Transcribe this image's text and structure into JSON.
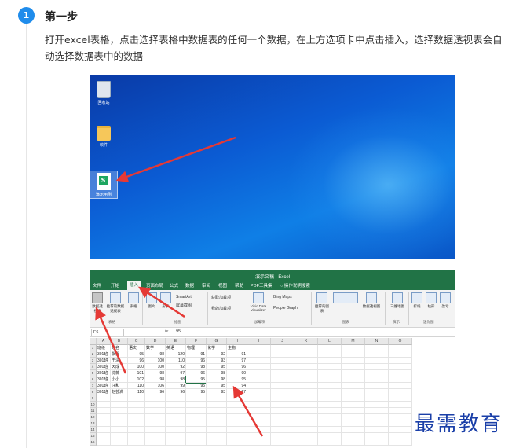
{
  "step": {
    "number": "1",
    "title": "第一步",
    "description": "打开excel表格，点击选择表格中数据表的任何一个数据，在上方选项卡中点击插入，选择数据透视表会自动选择数据表中的数据"
  },
  "desktop": {
    "icons": [
      {
        "name": "recycle-bin",
        "label": "回收站"
      },
      {
        "name": "folder",
        "label": "软件"
      },
      {
        "name": "wps-sheet",
        "label": "演示用例"
      }
    ]
  },
  "excel": {
    "title": "演示文稿 - Excel",
    "tabs": [
      "文件",
      "开始",
      "插入",
      "页面布局",
      "公式",
      "数据",
      "审阅",
      "视图",
      "帮助",
      "PDF工具集",
      "操作说明搜索"
    ],
    "active_tab": "插入",
    "ribbon": {
      "pivot_table": "数据透视表",
      "recommended_pivot": "推荐的数据透视表",
      "table": "表格",
      "group_tables": "表格",
      "pictures": "图片",
      "shapes": "形状",
      "smartart": "SmartArt",
      "screenshot": "屏幕截图",
      "group_illustrations": "插图",
      "get_addins": "获取加载项",
      "my_addins": "我的加载项",
      "visio": "Visio Data Visualizer",
      "bing_maps": "Bing Maps",
      "people_graph": "People Graph",
      "group_addins": "加载项",
      "recommended_charts": "推荐的图表",
      "pivot_chart": "数据透视图",
      "group_charts": "图表",
      "map3d": "三维地图",
      "group_tours": "演示",
      "line": "折线",
      "column": "柱形",
      "winloss": "盈亏",
      "group_sparklines": "迷你图"
    },
    "namebox": "F6",
    "fx": "fx",
    "formula_value": "95",
    "columns": [
      "A",
      "B",
      "C",
      "D",
      "E",
      "F",
      "G",
      "H",
      "I",
      "J",
      "K",
      "L",
      "M",
      "N",
      "O"
    ],
    "header_row": [
      "班级",
      "姓名",
      "语文",
      "数学",
      "英语",
      "物理",
      "化学",
      "生物"
    ],
    "rows": [
      [
        "301班",
        "飘飘",
        "95",
        "98",
        "120",
        "91",
        "92",
        "91"
      ],
      [
        "301班",
        "于清",
        "96",
        "100",
        "110",
        "96",
        "93",
        "97"
      ],
      [
        "301班",
        "天成",
        "100",
        "100",
        "92",
        "98",
        "95",
        "96"
      ],
      [
        "301班",
        "沈薇",
        "101",
        "98",
        "97",
        "96",
        "98",
        "90"
      ],
      [
        "301班",
        "小小",
        "102",
        "98",
        "98",
        "95",
        "98",
        "95"
      ],
      [
        "301班",
        "汪和",
        "110",
        "106",
        "99",
        "95",
        "95",
        "94"
      ],
      [
        "301班",
        "赵芸满",
        "110",
        "96",
        "96",
        "95",
        "93",
        "97"
      ]
    ],
    "row_numbers": [
      "1",
      "2",
      "3",
      "4",
      "5",
      "6",
      "7",
      "8",
      "9",
      "10",
      "11",
      "12",
      "13",
      "14",
      "15",
      "16",
      "17",
      "18",
      "19"
    ]
  },
  "watermark": "最需教育",
  "colors": {
    "badge": "#1f8ceb",
    "excel_green": "#217346",
    "desktop_blue": "#0b5bd3",
    "arrow": "#e53935",
    "watermark": "#1a3fa8"
  }
}
